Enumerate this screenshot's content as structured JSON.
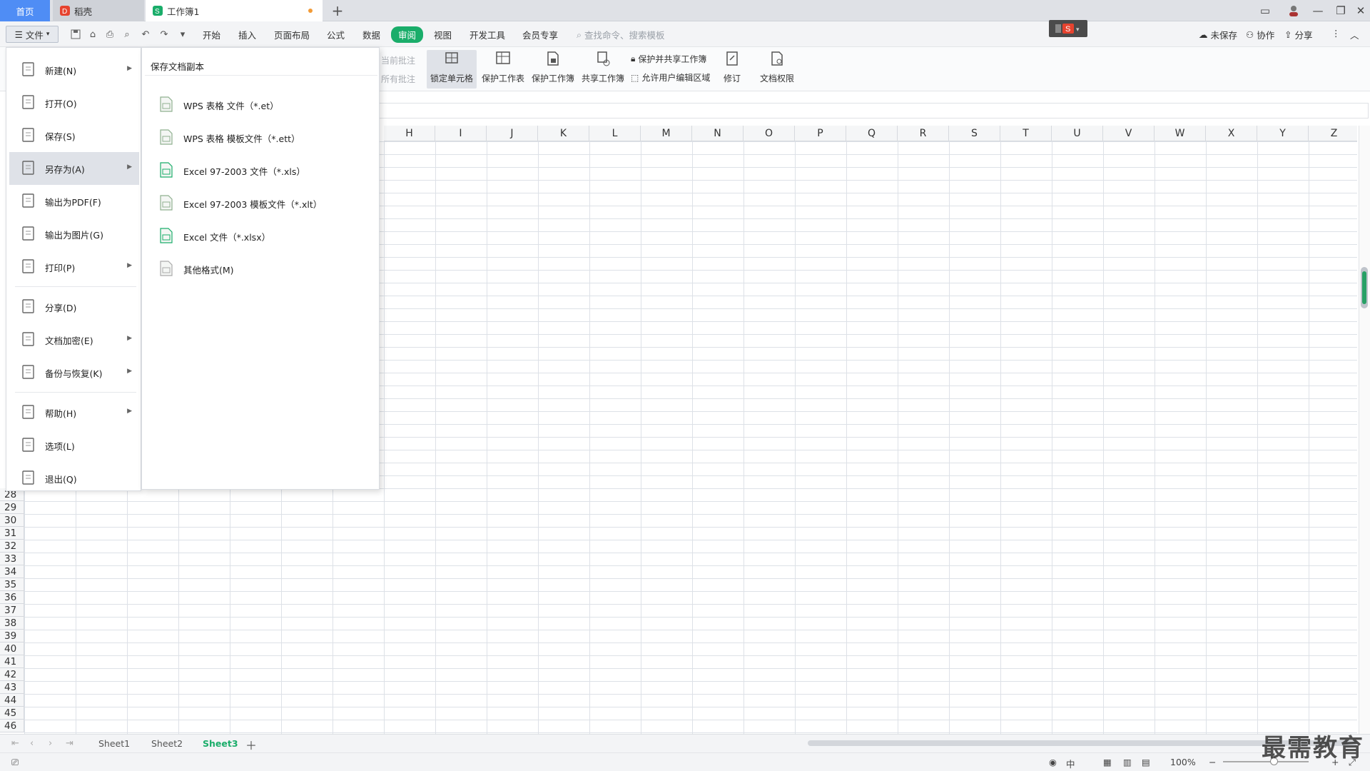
{
  "tabs": {
    "home": "首页",
    "daoke": "稻壳",
    "workbook": "工作簿1",
    "add": "+"
  },
  "menu": {
    "file": "文件",
    "items": [
      "开始",
      "插入",
      "页面布局",
      "公式",
      "数据",
      "审阅",
      "视图",
      "开发工具",
      "会员专享"
    ],
    "active": "审阅",
    "search_placeholder": "查找命令、搜索模板",
    "unsaved": "未保存",
    "collab": "协作",
    "share": "分享"
  },
  "ribbon": {
    "dim1": "当前批注",
    "dim2": "所有批注",
    "lock_cell": "锁定单元格",
    "protect_sheet": "保护工作表",
    "protect_book": "保护工作簿",
    "share_book": "共享工作簿",
    "protect_share": "保护并共享工作簿",
    "allow_edit": "允许用户编辑区域",
    "revise": "修订",
    "doc_rights": "文档权限"
  },
  "columns": [
    "H",
    "I",
    "J",
    "K",
    "L",
    "M",
    "N",
    "O",
    "P",
    "Q",
    "R",
    "S",
    "T",
    "U",
    "V",
    "W",
    "X",
    "Y",
    "Z"
  ],
  "rows": [
    "28",
    "29",
    "30",
    "31",
    "32",
    "33",
    "34",
    "35",
    "36",
    "37",
    "38",
    "39",
    "40",
    "41",
    "42",
    "43",
    "44",
    "45",
    "46"
  ],
  "file_menu": [
    {
      "label": "新建(N)",
      "icon": "new-file-icon",
      "arrow": true
    },
    {
      "label": "打开(O)",
      "icon": "open-folder-icon",
      "arrow": false
    },
    {
      "label": "保存(S)",
      "icon": "save-icon",
      "arrow": false
    },
    {
      "label": "另存为(A)",
      "icon": "save-as-icon",
      "arrow": true
    },
    {
      "label": "输出为PDF(F)",
      "icon": "pdf-icon",
      "arrow": false
    },
    {
      "label": "输出为图片(G)",
      "icon": "image-icon",
      "arrow": false
    },
    {
      "label": "打印(P)",
      "icon": "printer-icon",
      "arrow": true
    },
    {
      "label": "分享(D)",
      "icon": "share-icon",
      "arrow": false
    },
    {
      "label": "文档加密(E)",
      "icon": "encrypt-icon",
      "arrow": true
    },
    {
      "label": "备份与恢复(K)",
      "icon": "backup-icon",
      "arrow": true
    },
    {
      "label": "帮助(H)",
      "icon": "help-icon",
      "arrow": true
    },
    {
      "label": "选项(L)",
      "icon": "options-gear-icon",
      "arrow": false
    },
    {
      "label": "退出(Q)",
      "icon": "exit-icon",
      "arrow": false
    }
  ],
  "save_sub": {
    "title": "保存文档副本",
    "items": [
      {
        "label": "WPS 表格 文件（*.et）",
        "icon": "et-file-icon"
      },
      {
        "label": "WPS 表格 模板文件（*.ett）",
        "icon": "ett-file-icon"
      },
      {
        "label": "Excel 97-2003 文件（*.xls）",
        "icon": "xls-file-icon"
      },
      {
        "label": "Excel 97-2003 模板文件（*.xlt）",
        "icon": "xlt-file-icon"
      },
      {
        "label": "Excel 文件（*.xlsx）",
        "icon": "xlsx-file-icon"
      },
      {
        "label": "其他格式(M)",
        "icon": "other-format-icon"
      }
    ]
  },
  "sheets": [
    "Sheet1",
    "Sheet2",
    "Sheet3"
  ],
  "active_sheet": "Sheet3",
  "status": {
    "zoom": "100%",
    "zoom_minus": "−",
    "zoom_plus": "+"
  },
  "watermark": "最需教育",
  "colors": {
    "accent_green": "#1aad6a",
    "home_tab_blue": "#4f8df5",
    "unsaved_dot": "#f29b37"
  }
}
